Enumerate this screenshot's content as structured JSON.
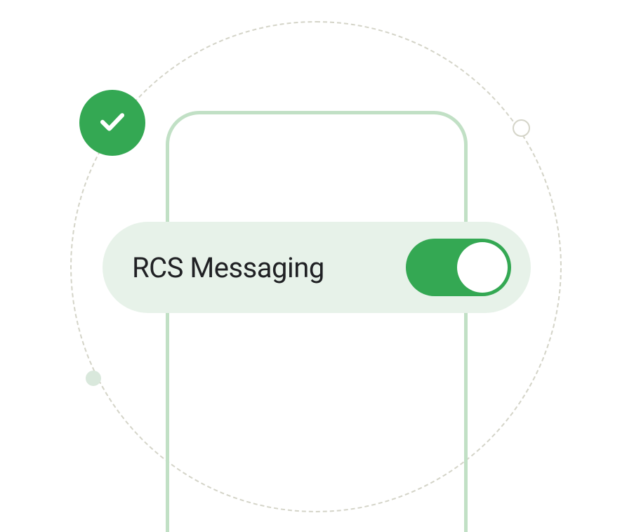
{
  "setting": {
    "label": "RCS Messaging",
    "enabled": true
  },
  "colors": {
    "green": "#34a853",
    "pill_bg": "#e7f2e9",
    "phone_outline": "#c1e0c5",
    "dashed": "#d4d4c8"
  }
}
